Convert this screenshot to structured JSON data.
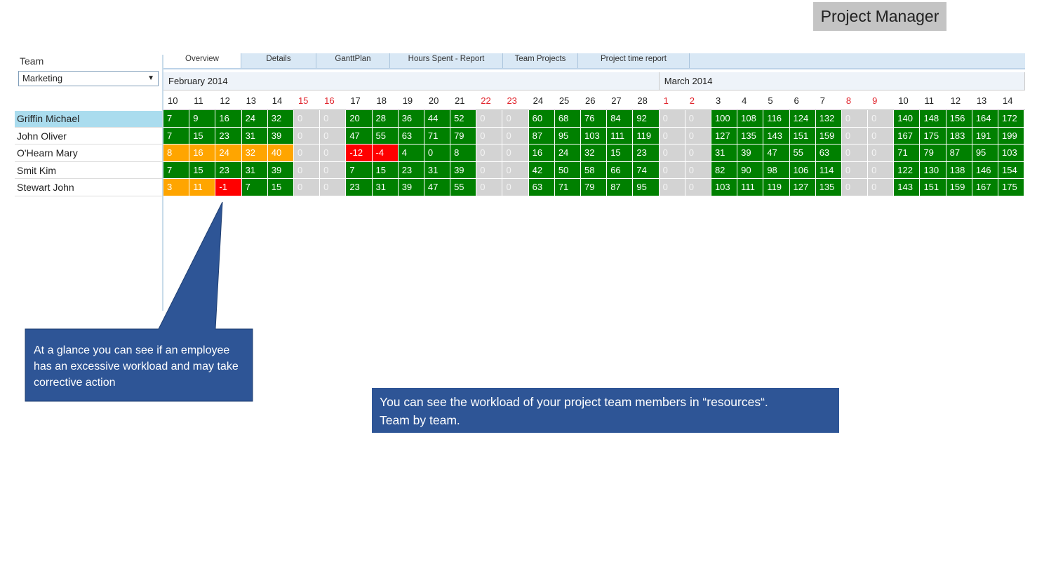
{
  "header": {
    "app_title": "Project Manager"
  },
  "filter": {
    "team_label": "Team",
    "team_value": "Marketing"
  },
  "tabs": [
    "Overview",
    "Details",
    "GanttPlan",
    "Hours Spent - Report",
    "Team Projects",
    "Project time report"
  ],
  "months": [
    {
      "label": "February 2014",
      "days": 19
    },
    {
      "label": "March 2014",
      "days": 14
    }
  ],
  "days": [
    {
      "d": "10",
      "w": false
    },
    {
      "d": "11",
      "w": false
    },
    {
      "d": "12",
      "w": false
    },
    {
      "d": "13",
      "w": false
    },
    {
      "d": "14",
      "w": false
    },
    {
      "d": "15",
      "w": true
    },
    {
      "d": "16",
      "w": true
    },
    {
      "d": "17",
      "w": false
    },
    {
      "d": "18",
      "w": false
    },
    {
      "d": "19",
      "w": false
    },
    {
      "d": "20",
      "w": false
    },
    {
      "d": "21",
      "w": false
    },
    {
      "d": "22",
      "w": true
    },
    {
      "d": "23",
      "w": true
    },
    {
      "d": "24",
      "w": false
    },
    {
      "d": "25",
      "w": false
    },
    {
      "d": "26",
      "w": false
    },
    {
      "d": "27",
      "w": false
    },
    {
      "d": "28",
      "w": false
    },
    {
      "d": "1",
      "w": true
    },
    {
      "d": "2",
      "w": true
    },
    {
      "d": "3",
      "w": false
    },
    {
      "d": "4",
      "w": false
    },
    {
      "d": "5",
      "w": false
    },
    {
      "d": "6",
      "w": false
    },
    {
      "d": "7",
      "w": false
    },
    {
      "d": "8",
      "w": true
    },
    {
      "d": "9",
      "w": true
    },
    {
      "d": "10",
      "w": false
    },
    {
      "d": "11",
      "w": false
    },
    {
      "d": "12",
      "w": false
    },
    {
      "d": "13",
      "w": false
    },
    {
      "d": "14",
      "w": false
    }
  ],
  "colors": {
    "ok": "#008000",
    "warning": "#ffa500",
    "overload": "#ff0000",
    "weekend": "#d3d3d3",
    "callout": "#2e5596"
  },
  "employees": [
    {
      "name": "Griffin Michael",
      "selected": true,
      "values": [
        "7",
        "9",
        "16",
        "24",
        "32",
        "0",
        "0",
        "20",
        "28",
        "36",
        "44",
        "52",
        "0",
        "0",
        "60",
        "68",
        "76",
        "84",
        "92",
        "0",
        "0",
        "100",
        "108",
        "116",
        "124",
        "132",
        "0",
        "0",
        "140",
        "148",
        "156",
        "164",
        "172"
      ],
      "status": [
        "g",
        "g",
        "g",
        "g",
        "g",
        "x",
        "x",
        "g",
        "g",
        "g",
        "g",
        "g",
        "x",
        "x",
        "g",
        "g",
        "g",
        "g",
        "g",
        "x",
        "x",
        "g",
        "g",
        "g",
        "g",
        "g",
        "x",
        "x",
        "g",
        "g",
        "g",
        "g",
        "g"
      ]
    },
    {
      "name": "John Oliver",
      "selected": false,
      "values": [
        "7",
        "15",
        "23",
        "31",
        "39",
        "0",
        "0",
        "47",
        "55",
        "63",
        "71",
        "79",
        "0",
        "0",
        "87",
        "95",
        "103",
        "111",
        "119",
        "0",
        "0",
        "127",
        "135",
        "143",
        "151",
        "159",
        "0",
        "0",
        "167",
        "175",
        "183",
        "191",
        "199"
      ],
      "status": [
        "g",
        "g",
        "g",
        "g",
        "g",
        "x",
        "x",
        "g",
        "g",
        "g",
        "g",
        "g",
        "x",
        "x",
        "g",
        "g",
        "g",
        "g",
        "g",
        "x",
        "x",
        "g",
        "g",
        "g",
        "g",
        "g",
        "x",
        "x",
        "g",
        "g",
        "g",
        "g",
        "g"
      ]
    },
    {
      "name": "O'Hearn Mary",
      "selected": false,
      "values": [
        "8",
        "16",
        "24",
        "32",
        "40",
        "0",
        "0",
        "-12",
        "-4",
        "4",
        "0",
        "8",
        "0",
        "0",
        "16",
        "24",
        "32",
        "15",
        "23",
        "0",
        "0",
        "31",
        "39",
        "47",
        "55",
        "63",
        "0",
        "0",
        "71",
        "79",
        "87",
        "95",
        "103"
      ],
      "status": [
        "o",
        "o",
        "o",
        "o",
        "o",
        "x",
        "x",
        "r",
        "r",
        "g",
        "g",
        "g",
        "x",
        "x",
        "g",
        "g",
        "g",
        "g",
        "g",
        "x",
        "x",
        "g",
        "g",
        "g",
        "g",
        "g",
        "x",
        "x",
        "g",
        "g",
        "g",
        "g",
        "g"
      ]
    },
    {
      "name": "Smit Kim",
      "selected": false,
      "values": [
        "7",
        "15",
        "23",
        "31",
        "39",
        "0",
        "0",
        "7",
        "15",
        "23",
        "31",
        "39",
        "0",
        "0",
        "42",
        "50",
        "58",
        "66",
        "74",
        "0",
        "0",
        "82",
        "90",
        "98",
        "106",
        "114",
        "0",
        "0",
        "122",
        "130",
        "138",
        "146",
        "154"
      ],
      "status": [
        "g",
        "g",
        "g",
        "g",
        "g",
        "x",
        "x",
        "g",
        "g",
        "g",
        "g",
        "g",
        "x",
        "x",
        "g",
        "g",
        "g",
        "g",
        "g",
        "x",
        "x",
        "g",
        "g",
        "g",
        "g",
        "g",
        "x",
        "x",
        "g",
        "g",
        "g",
        "g",
        "g"
      ]
    },
    {
      "name": "Stewart John",
      "selected": false,
      "values": [
        "3",
        "11",
        "-1",
        "7",
        "15",
        "0",
        "0",
        "23",
        "31",
        "39",
        "47",
        "55",
        "0",
        "0",
        "63",
        "71",
        "79",
        "87",
        "95",
        "0",
        "0",
        "103",
        "111",
        "119",
        "127",
        "135",
        "0",
        "0",
        "143",
        "151",
        "159",
        "167",
        "175"
      ],
      "status": [
        "o",
        "o",
        "r",
        "g",
        "g",
        "x",
        "x",
        "g",
        "g",
        "g",
        "g",
        "g",
        "x",
        "x",
        "g",
        "g",
        "g",
        "g",
        "g",
        "x",
        "x",
        "g",
        "g",
        "g",
        "g",
        "g",
        "x",
        "x",
        "g",
        "g",
        "g",
        "g",
        "g"
      ]
    }
  ],
  "callout": {
    "text": "At a glance you can see if an employee has an excessive workload and may take corrective action"
  },
  "info": {
    "line1": "You can see the workload of your project team members  in “resources“.",
    "line2": "Team by team."
  }
}
